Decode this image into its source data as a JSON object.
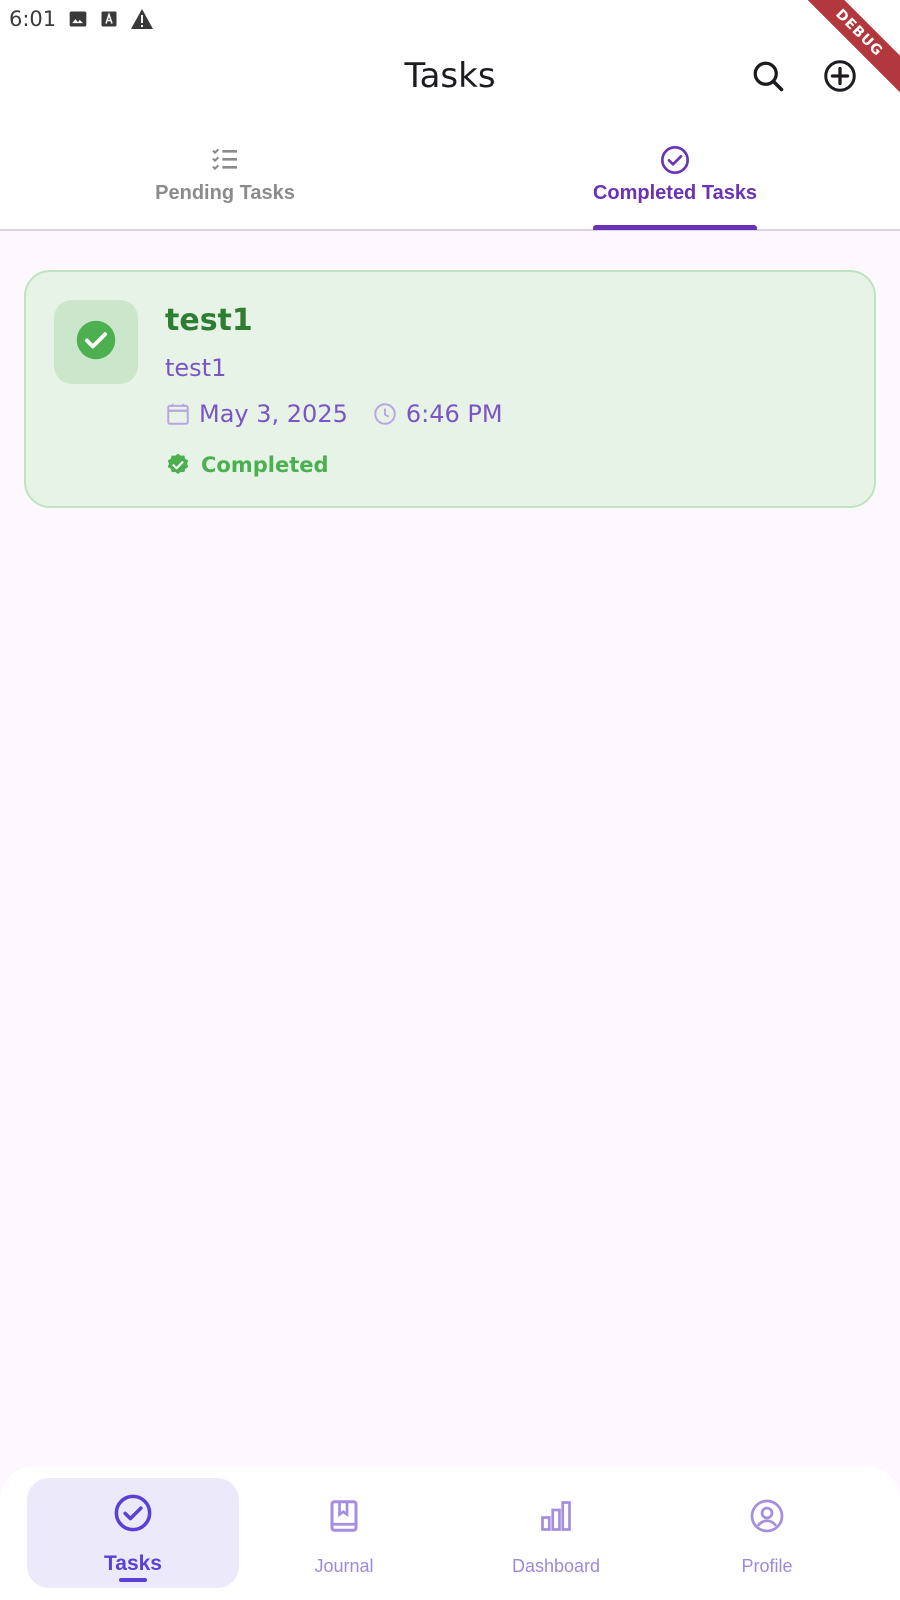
{
  "status_bar": {
    "time": "6:01",
    "icons": [
      "image-icon",
      "text-a-icon",
      "warning-icon"
    ],
    "debug_label": "DEBUG"
  },
  "app_bar": {
    "title": "Tasks",
    "actions": [
      "search-icon",
      "add-circle-icon"
    ]
  },
  "tabs": [
    {
      "label": "Pending Tasks",
      "icon": "checklist-icon",
      "selected": false
    },
    {
      "label": "Completed Tasks",
      "icon": "check-circle-icon",
      "selected": true
    }
  ],
  "tasks": [
    {
      "title": "test1",
      "description": "test1",
      "date": "May 3, 2025",
      "time": "6:46 PM",
      "status": "Completed"
    }
  ],
  "bottom_nav": {
    "items": [
      {
        "label": "Tasks",
        "icon": "check-circle-icon",
        "active": true
      },
      {
        "label": "Journal",
        "icon": "book-icon",
        "active": false
      },
      {
        "label": "Dashboard",
        "icon": "bar-chart-icon",
        "active": false
      },
      {
        "label": "Profile",
        "icon": "account-circle-icon",
        "active": false
      }
    ]
  },
  "colors": {
    "primary": "#6a32b6",
    "success": "#4caf50",
    "success_dark": "#2e7d32",
    "card_bg": "#e6f3e6",
    "background": "#fdf7fe",
    "nav_active": "#5b3fd6"
  }
}
